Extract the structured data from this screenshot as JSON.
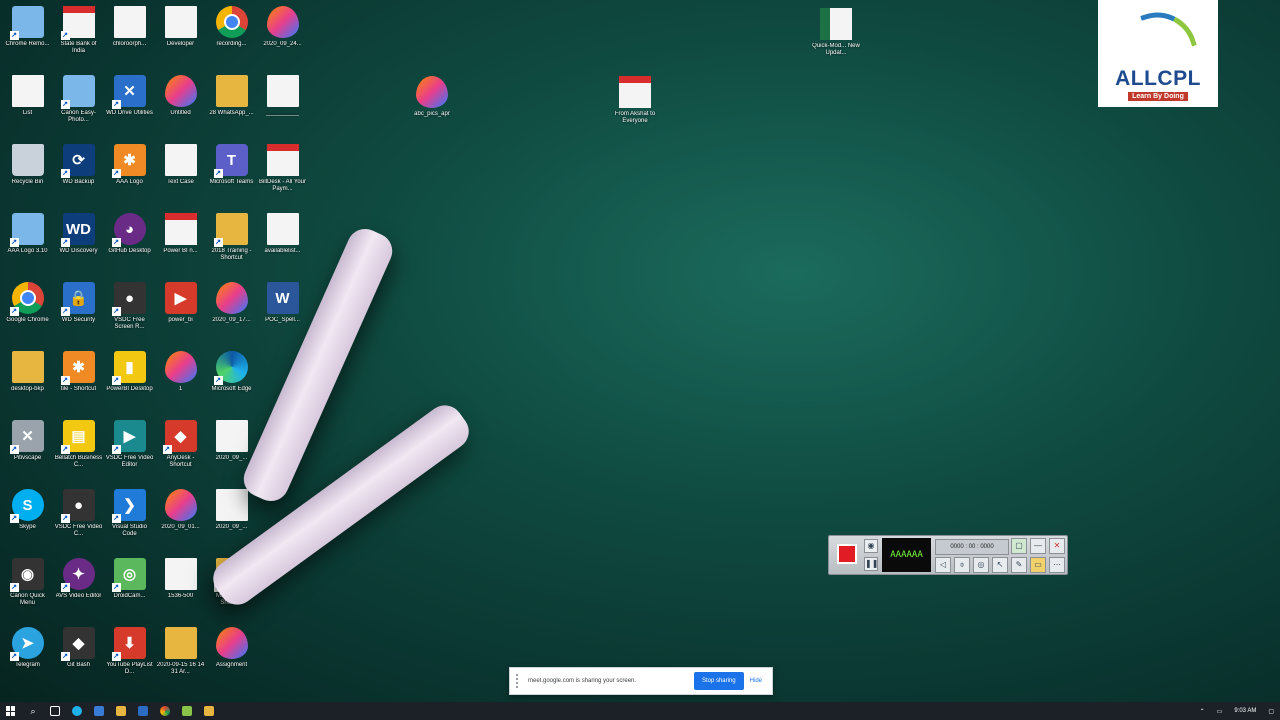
{
  "desktop_icons": [
    {
      "label": "Chrome Remo...",
      "kind": "k-sky",
      "glyph": "",
      "shortcut": true
    },
    {
      "label": "State Bank of India",
      "kind": "k-pdf",
      "glyph": "",
      "shortcut": true
    },
    {
      "label": "chloroorph...",
      "kind": "k-doc",
      "glyph": "",
      "shortcut": false
    },
    {
      "label": "Developer",
      "kind": "k-doc",
      "glyph": "",
      "shortcut": false
    },
    {
      "label": "recording...",
      "kind": "k-chrome",
      "glyph": "",
      "shortcut": false
    },
    {
      "label": "2020_09_24...",
      "kind": "k-drop",
      "glyph": "",
      "shortcut": false
    },
    {
      "label": "List",
      "kind": "k-doc",
      "glyph": "",
      "shortcut": false
    },
    {
      "label": "Canon Easy-Photo...",
      "kind": "k-sky",
      "glyph": "",
      "shortcut": true
    },
    {
      "label": "WD Drive Utilities",
      "kind": "k-blue",
      "glyph": "✕",
      "shortcut": true
    },
    {
      "label": "Untitled",
      "kind": "k-drop",
      "glyph": "",
      "shortcut": false
    },
    {
      "label": "28 WhatsApp_...",
      "kind": "k-folder",
      "glyph": "",
      "shortcut": false
    },
    {
      "label": "__________",
      "kind": "k-doc",
      "glyph": "",
      "shortcut": false
    },
    {
      "label": "Recycle Bin",
      "kind": "k-bin",
      "glyph": "",
      "shortcut": false
    },
    {
      "label": "WD Backup",
      "kind": "k-navy",
      "glyph": "⟳",
      "shortcut": true
    },
    {
      "label": "AAA Logo",
      "kind": "k-orange",
      "glyph": "✱",
      "shortcut": true
    },
    {
      "label": "Text Case",
      "kind": "k-doc",
      "glyph": "",
      "shortcut": false
    },
    {
      "label": "Microsoft Teams",
      "kind": "k-teams",
      "glyph": "T",
      "shortcut": true
    },
    {
      "label": "BillDesk - All Your Paym...",
      "kind": "k-pdf",
      "glyph": "",
      "shortcut": false
    },
    {
      "label": "AAA Logo 3.10",
      "kind": "k-sky",
      "glyph": "",
      "shortcut": true
    },
    {
      "label": "WD Discovery",
      "kind": "k-navy",
      "glyph": "WD",
      "shortcut": true
    },
    {
      "label": "GitHub Desktop",
      "kind": "k-purple",
      "glyph": "◕",
      "shortcut": true
    },
    {
      "label": "Power BI n...",
      "kind": "k-pdf",
      "glyph": "",
      "shortcut": false
    },
    {
      "label": "2018 Training - Shortcut",
      "kind": "k-folder",
      "glyph": "",
      "shortcut": true
    },
    {
      "label": "availablelist...",
      "kind": "k-doc",
      "glyph": "",
      "shortcut": false
    },
    {
      "label": "Google Chrome",
      "kind": "k-chrome",
      "glyph": "",
      "shortcut": true
    },
    {
      "label": "WD Security",
      "kind": "k-blue",
      "glyph": "🔒",
      "shortcut": true
    },
    {
      "label": "VSDC Free Screen R...",
      "kind": "k-dark",
      "glyph": "●",
      "shortcut": true
    },
    {
      "label": "power_bi",
      "kind": "k-red",
      "glyph": "▶",
      "shortcut": false
    },
    {
      "label": "2020_09_17...",
      "kind": "k-drop",
      "glyph": "",
      "shortcut": false
    },
    {
      "label": "POC_Spell...",
      "kind": "k-word",
      "glyph": "W",
      "shortcut": false
    },
    {
      "label": "desktop-bkp",
      "kind": "k-folder",
      "glyph": "",
      "shortcut": false
    },
    {
      "label": "tile - Shortcut",
      "kind": "k-orange",
      "glyph": "✱",
      "shortcut": true
    },
    {
      "label": "PowerBI Desktop",
      "kind": "k-gold",
      "glyph": "▮",
      "shortcut": true
    },
    {
      "label": "1",
      "kind": "k-drop",
      "glyph": "",
      "shortcut": false
    },
    {
      "label": "Microsoft Edge",
      "kind": "k-edge",
      "glyph": "",
      "shortcut": true
    },
    {
      "label": "",
      "kind": "",
      "glyph": "",
      "shortcut": false
    },
    {
      "label": "Pitivscape",
      "kind": "k-gray",
      "glyph": "✕",
      "shortcut": true
    },
    {
      "label": "Bellatch Business C...",
      "kind": "k-gold",
      "glyph": "▤",
      "shortcut": true
    },
    {
      "label": "VSDC Free Video Editor",
      "kind": "k-teal",
      "glyph": "▶",
      "shortcut": true
    },
    {
      "label": "AnyDesk - Shortcut",
      "kind": "k-red",
      "glyph": "◆",
      "shortcut": true
    },
    {
      "label": "2020_09_...",
      "kind": "k-doc",
      "glyph": "",
      "shortcut": false
    },
    {
      "label": "",
      "kind": "",
      "glyph": "",
      "shortcut": false
    },
    {
      "label": "Skype",
      "kind": "k-skype",
      "glyph": "S",
      "shortcut": true
    },
    {
      "label": "VSDC Free Video C...",
      "kind": "k-dark",
      "glyph": "●",
      "shortcut": true
    },
    {
      "label": "Visual Studio Code",
      "kind": "k-vscode",
      "glyph": "❯",
      "shortcut": true
    },
    {
      "label": "2020_09_01...",
      "kind": "k-drop",
      "glyph": "",
      "shortcut": false
    },
    {
      "label": "2020_09_...",
      "kind": "k-doc",
      "glyph": "",
      "shortcut": false
    },
    {
      "label": "",
      "kind": "",
      "glyph": "",
      "shortcut": false
    },
    {
      "label": "Canon Quick Menu",
      "kind": "k-dark",
      "glyph": "◉",
      "shortcut": true
    },
    {
      "label": "AVS Video Editor",
      "kind": "k-purple",
      "glyph": "✦",
      "shortcut": true
    },
    {
      "label": "DroidCam...",
      "kind": "k-green",
      "glyph": "◎",
      "shortcut": true
    },
    {
      "label": "1536-500",
      "kind": "k-doc",
      "glyph": "",
      "shortcut": false
    },
    {
      "label": "MIS_DOC - Shortcut",
      "kind": "k-folder",
      "glyph": "",
      "shortcut": true
    },
    {
      "label": "",
      "kind": "",
      "glyph": "",
      "shortcut": false
    },
    {
      "label": "Telegram",
      "kind": "k-tele",
      "glyph": "➤",
      "shortcut": true
    },
    {
      "label": "Git Bash",
      "kind": "k-dark",
      "glyph": "◆",
      "shortcut": true
    },
    {
      "label": "YouTube PlayList D...",
      "kind": "k-red",
      "glyph": "⬇",
      "shortcut": true
    },
    {
      "label": "2020-09-15 16 14 31 Ar...",
      "kind": "k-folder",
      "glyph": "",
      "shortcut": false
    },
    {
      "label": "Assignment",
      "kind": "k-drop",
      "glyph": "",
      "shortcut": false
    },
    {
      "label": "",
      "kind": "",
      "glyph": "",
      "shortcut": false
    }
  ],
  "free_icons": [
    {
      "label": "Quick-Mod... New Updat...",
      "kind": "k-xls",
      "glyph": ""
    },
    {
      "label": "abc_pics_apr",
      "kind": "k-drop",
      "glyph": ""
    },
    {
      "label": "From Akshat to Everyone",
      "kind": "k-pdf",
      "glyph": ""
    }
  ],
  "logo": {
    "name": "ALLCPL",
    "tagline": "Learn By Doing"
  },
  "recorder": {
    "display": "AAAAAA",
    "time": "0000 : 00 : 0000"
  },
  "share_bar": {
    "message": "meet.google.com is sharing your screen.",
    "stop_label": "Stop sharing",
    "hide_label": "Hide"
  },
  "taskbar": {
    "clock": "9:03 AM"
  }
}
